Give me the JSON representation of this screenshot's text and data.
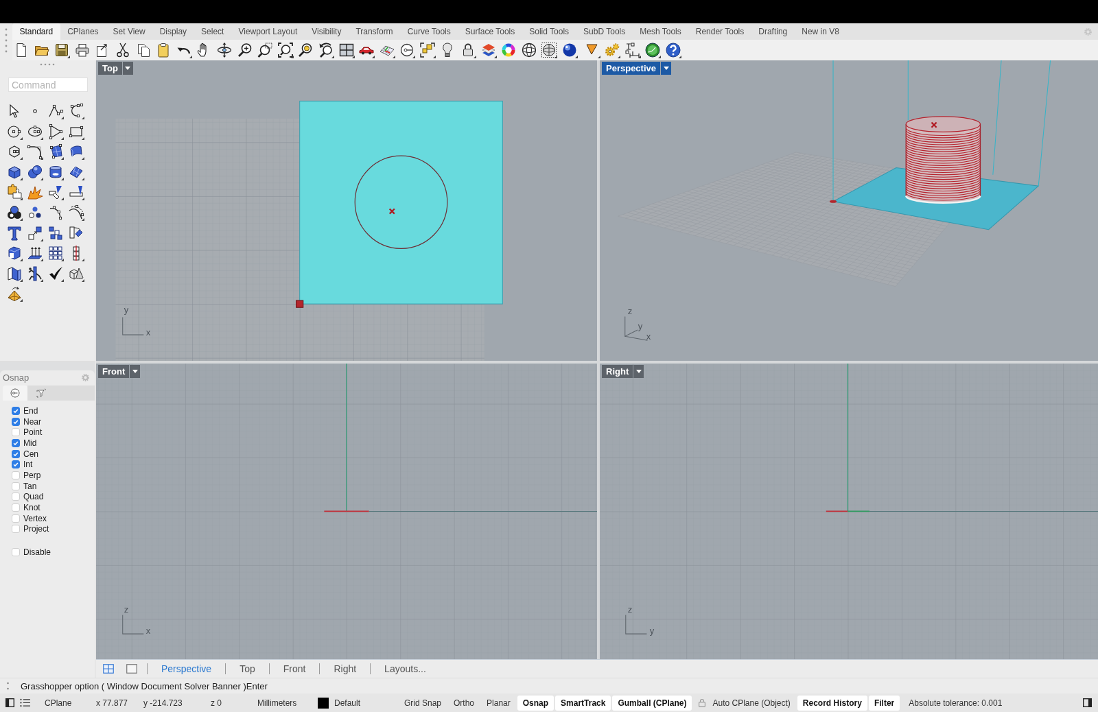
{
  "tabs": [
    {
      "label": "Standard",
      "selected": true
    },
    {
      "label": "CPlanes",
      "selected": false
    },
    {
      "label": "Set View",
      "selected": false
    },
    {
      "label": "Display",
      "selected": false
    },
    {
      "label": "Select",
      "selected": false
    },
    {
      "label": "Viewport Layout",
      "selected": false
    },
    {
      "label": "Visibility",
      "selected": false
    },
    {
      "label": "Transform",
      "selected": false
    },
    {
      "label": "Curve Tools",
      "selected": false
    },
    {
      "label": "Surface Tools",
      "selected": false
    },
    {
      "label": "Solid Tools",
      "selected": false
    },
    {
      "label": "SubD Tools",
      "selected": false
    },
    {
      "label": "Mesh Tools",
      "selected": false
    },
    {
      "label": "Render Tools",
      "selected": false
    },
    {
      "label": "Drafting",
      "selected": false
    },
    {
      "label": "New in V8",
      "selected": false
    }
  ],
  "command": {
    "placeholder": "Command"
  },
  "osnap": {
    "title": "Osnap",
    "tabs": [
      {
        "kind": "snap",
        "selected": true
      },
      {
        "kind": "filter",
        "selected": false
      }
    ],
    "items": [
      {
        "label": "End",
        "checked": true
      },
      {
        "label": "Near",
        "checked": true
      },
      {
        "label": "Point",
        "checked": false
      },
      {
        "label": "Mid",
        "checked": true
      },
      {
        "label": "Cen",
        "checked": true
      },
      {
        "label": "Int",
        "checked": true
      },
      {
        "label": "Perp",
        "checked": false
      },
      {
        "label": "Tan",
        "checked": false
      },
      {
        "label": "Quad",
        "checked": false
      },
      {
        "label": "Knot",
        "checked": false
      },
      {
        "label": "Vertex",
        "checked": false
      },
      {
        "label": "Project",
        "checked": false
      }
    ],
    "disable": {
      "label": "Disable",
      "checked": false
    }
  },
  "viewports": [
    {
      "name": "Top",
      "kind": "top",
      "selected": false,
      "axes": [
        "y",
        "x"
      ]
    },
    {
      "name": "Perspective",
      "kind": "perspective",
      "selected": true,
      "axes": [
        "z",
        "y",
        "x"
      ]
    },
    {
      "name": "Front",
      "kind": "front",
      "selected": false,
      "axes": [
        "z",
        "x"
      ]
    },
    {
      "name": "Right",
      "kind": "right",
      "selected": false,
      "axes": [
        "z",
        "y"
      ]
    }
  ],
  "view_tabs": {
    "tabs": [
      {
        "label": "Perspective",
        "selected": true
      },
      {
        "label": "Top",
        "selected": false
      },
      {
        "label": "Front",
        "selected": false
      },
      {
        "label": "Right",
        "selected": false
      }
    ],
    "layouts": "Layouts..."
  },
  "command_line": "Grasshopper option ( Window Document Solver Banner )Enter",
  "status_bar": {
    "cplane": "CPlane",
    "x": "x 77.877",
    "y": "y -214.723",
    "z": "z 0",
    "units": "Millimeters",
    "layer": "Default",
    "toggles": [
      {
        "label": "Grid Snap",
        "on": false,
        "kind": "plain"
      },
      {
        "label": "Ortho",
        "on": false,
        "kind": "plain"
      },
      {
        "label": "Planar",
        "on": false,
        "kind": "plain"
      },
      {
        "label": "Osnap",
        "on": true,
        "kind": "plain"
      },
      {
        "label": "SmartTrack",
        "on": true,
        "kind": "plain"
      },
      {
        "label": "Gumball (CPlane)",
        "on": true,
        "kind": "plain"
      },
      {
        "label": "Auto CPlane (Object)",
        "on": false,
        "kind": "locked"
      },
      {
        "label": "Record History",
        "on": true,
        "kind": "plain"
      },
      {
        "label": "Filter",
        "on": true,
        "kind": "plain"
      }
    ],
    "tolerance": "Absolute tolerance: 0.001"
  }
}
